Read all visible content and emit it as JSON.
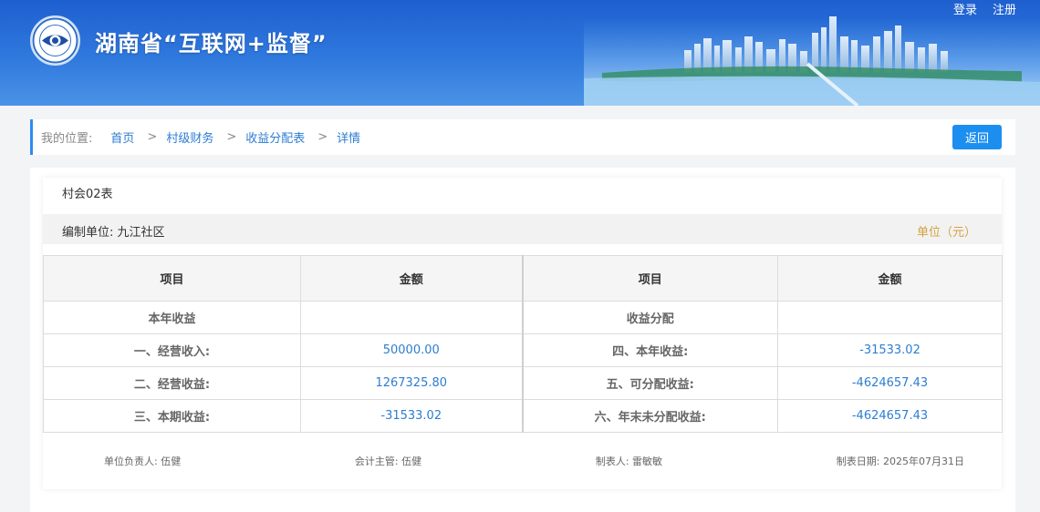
{
  "header": {
    "title": "湖南省“互联网+监督”",
    "login": "登录",
    "register": "注册"
  },
  "breadcrumb": {
    "location_label": "我的位置:",
    "items": [
      "首页",
      "村级财务",
      "收益分配表",
      "详情"
    ],
    "separator": ">",
    "back_label": "返回"
  },
  "report": {
    "form_no": "村会02表",
    "org_label": "编制单位: 九江社区",
    "unit_label": "单位（元）",
    "headers": [
      "项目",
      "金额",
      "项目",
      "金额"
    ],
    "rows": [
      {
        "left_label": "本年收益",
        "left_value": "",
        "right_label": "收益分配",
        "right_value": ""
      },
      {
        "left_label": "一、经营收入:",
        "left_value": "50000.00",
        "right_label": "四、本年收益:",
        "right_value": "-31533.02"
      },
      {
        "left_label": "二、经营收益:",
        "left_value": "1267325.80",
        "right_label": "五、可分配收益:",
        "right_value": "-4624657.43"
      },
      {
        "left_label": "三、本期收益:",
        "left_value": "-31533.02",
        "right_label": "六、年末未分配收益:",
        "right_value": "-4624657.43"
      }
    ],
    "footer": {
      "head": "单位负责人: 伍健",
      "accountant": "会计主管: 伍健",
      "preparer": "制表人: 雷敏敏",
      "date": "制表日期: 2025年07月31日"
    }
  },
  "colors": {
    "header_blue": "#2f79de",
    "link_blue": "#2d7dd2",
    "button_blue": "#1c8ef0",
    "unit_gold": "#d4a33c"
  },
  "icons": {
    "logo": "eye-seal-logo"
  }
}
